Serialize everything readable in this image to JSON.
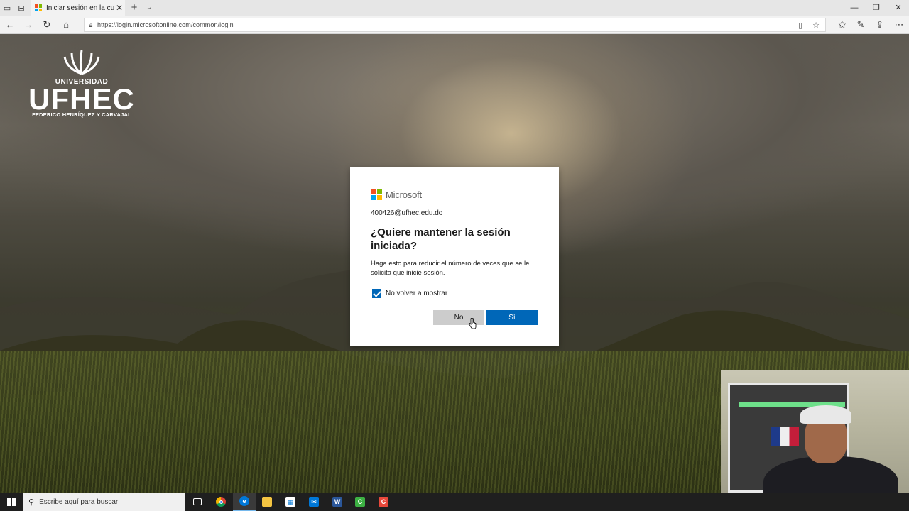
{
  "browser": {
    "tab_title": "Iniciar sesión en la cuen",
    "url": "https://login.microsoftonline.com/common/login"
  },
  "branding": {
    "univ_label": "UNIVERSIDAD",
    "name": "UFHEC",
    "subtitle": "FEDERICO HENRÍQUEZ Y CARVAJAL"
  },
  "dialog": {
    "brand": "Microsoft",
    "email": "400426@ufhec.edu.do",
    "heading": "¿Quiere mantener la sesión iniciada?",
    "description": "Haga esto para reducir el número de veces que se le solicita que inicie sesión.",
    "checkbox_label": "No volver a mostrar",
    "checkbox_checked": true,
    "no_label": "No",
    "yes_label": "Sí",
    "accent_color": "#0067b8"
  },
  "taskbar": {
    "search_placeholder": "Escribe aquí para buscar",
    "apps": [
      "task-view-icon",
      "chrome-icon",
      "edge-icon",
      "file-explorer-icon",
      "store-icon",
      "mail-icon",
      "word-icon",
      "camtasia-icon",
      "camtasia-recorder-icon"
    ]
  }
}
